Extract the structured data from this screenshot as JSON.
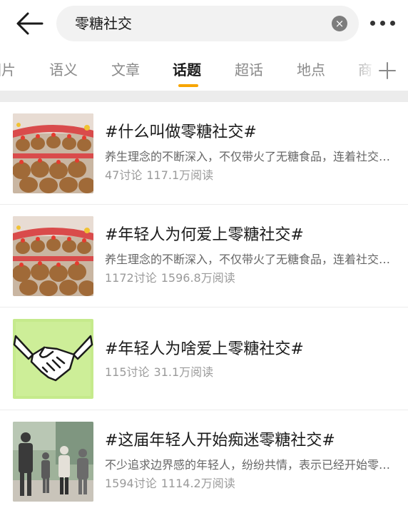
{
  "search": {
    "query": "零糖社交",
    "clear_glyph": "×",
    "back_icon": "arrow-left-icon",
    "more_icon": "more-dots-icon"
  },
  "tabs": [
    {
      "label": "图片"
    },
    {
      "label": "语义"
    },
    {
      "label": "文章"
    },
    {
      "label": "话题",
      "active": true
    },
    {
      "label": "超话"
    },
    {
      "label": "地点"
    },
    {
      "label": "商"
    }
  ],
  "add_tab_icon": "plus-icon",
  "accent_color": "#f7a500",
  "topics": [
    {
      "title": "#什么叫做零糖社交#",
      "desc": "养生理念的不断深入，不仅带火了无糖食品，连着社交都开始追求零糖了",
      "discussions": "47讨论",
      "reads": "117.1万阅读",
      "thumb_icon": "capybara-plush-photo"
    },
    {
      "title": "#年轻人为何爱上零糖社交#",
      "desc": "养生理念的不断深入，不仅带火了无糖食品，连着社交都开始追求零糖了",
      "discussions": "1172讨论",
      "reads": "1596.8万阅读",
      "thumb_icon": "capybara-plush-photo"
    },
    {
      "title": "#年轻人为啥爱上零糖社交#",
      "desc": "",
      "discussions": "115讨论",
      "reads": "31.1万阅读",
      "thumb_icon": "handshake-icon"
    },
    {
      "title": "#这届年轻人开始痴迷零糖社交#",
      "desc": "不少追求边界感的年轻人，纷纷共情，表示已经开始零糖社交了",
      "discussions": "1594讨论",
      "reads": "1114.2万阅读",
      "thumb_icon": "people-street-photo"
    }
  ]
}
